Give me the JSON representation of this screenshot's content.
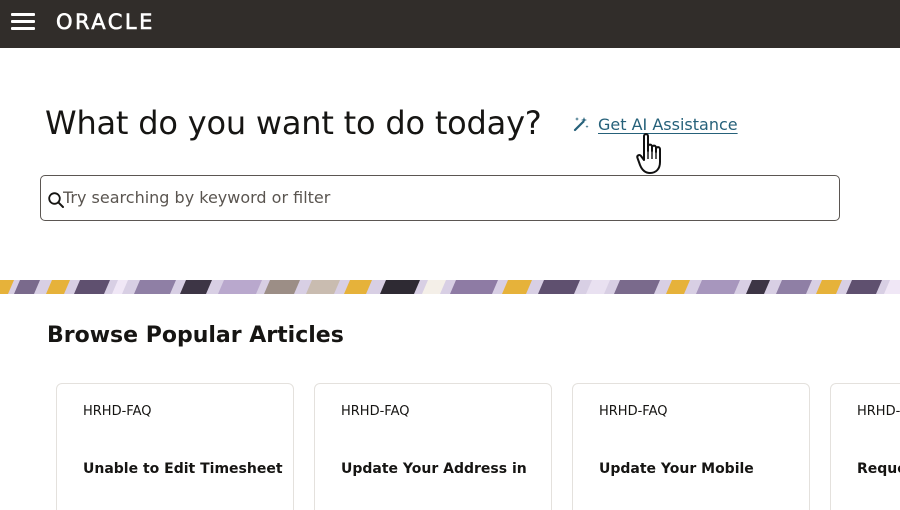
{
  "header": {
    "logo_text": "ORACLE",
    "menu_icon": "hamburger-menu-icon",
    "background_color": "#312d2a"
  },
  "hero": {
    "headline": "What do you want to do today?",
    "ai_link_label": "Get AI Assistance",
    "ai_link_icon": "magic-wand-icon",
    "ai_link_color": "#26617a"
  },
  "search": {
    "placeholder": "Try searching by keyword or filter",
    "value": "",
    "icon": "search-icon"
  },
  "articles": {
    "section_title": "Browse Popular Articles",
    "cards": [
      {
        "tag": "HRHD-FAQ",
        "title": "Unable to Edit Timesheet"
      },
      {
        "tag": "HRHD-FAQ",
        "title": "Update Your Address in"
      },
      {
        "tag": "HRHD-FAQ",
        "title": "Update Your Mobile"
      },
      {
        "tag": "HRHD-",
        "title": "Reque"
      }
    ]
  },
  "pointer": {
    "icon": "hand-pointer-cursor-icon"
  }
}
